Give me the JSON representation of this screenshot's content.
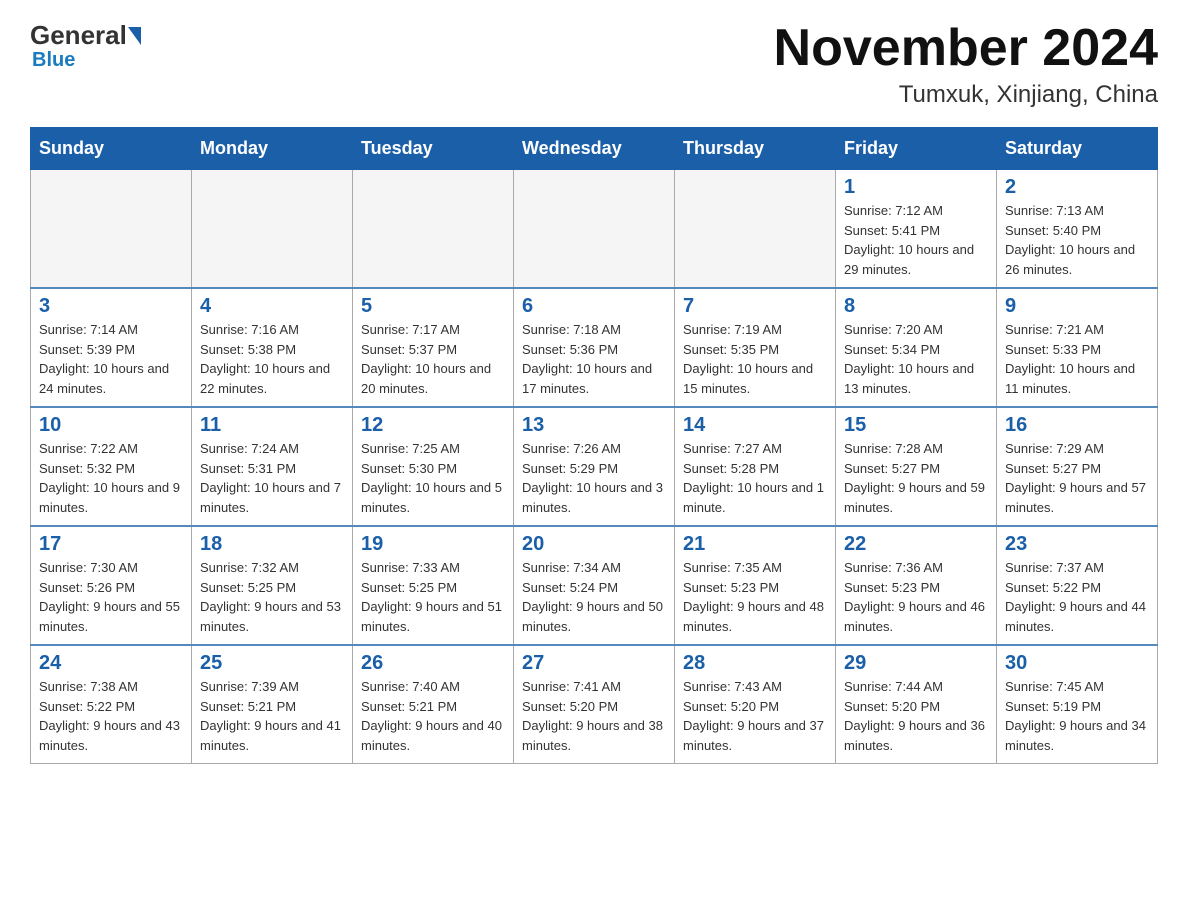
{
  "header": {
    "logo_general": "General",
    "logo_blue": "Blue",
    "title": "November 2024",
    "subtitle": "Tumxuk, Xinjiang, China"
  },
  "days_of_week": [
    "Sunday",
    "Monday",
    "Tuesday",
    "Wednesday",
    "Thursday",
    "Friday",
    "Saturday"
  ],
  "weeks": [
    [
      {
        "day": "",
        "info": ""
      },
      {
        "day": "",
        "info": ""
      },
      {
        "day": "",
        "info": ""
      },
      {
        "day": "",
        "info": ""
      },
      {
        "day": "",
        "info": ""
      },
      {
        "day": "1",
        "info": "Sunrise: 7:12 AM\nSunset: 5:41 PM\nDaylight: 10 hours and 29 minutes."
      },
      {
        "day": "2",
        "info": "Sunrise: 7:13 AM\nSunset: 5:40 PM\nDaylight: 10 hours and 26 minutes."
      }
    ],
    [
      {
        "day": "3",
        "info": "Sunrise: 7:14 AM\nSunset: 5:39 PM\nDaylight: 10 hours and 24 minutes."
      },
      {
        "day": "4",
        "info": "Sunrise: 7:16 AM\nSunset: 5:38 PM\nDaylight: 10 hours and 22 minutes."
      },
      {
        "day": "5",
        "info": "Sunrise: 7:17 AM\nSunset: 5:37 PM\nDaylight: 10 hours and 20 minutes."
      },
      {
        "day": "6",
        "info": "Sunrise: 7:18 AM\nSunset: 5:36 PM\nDaylight: 10 hours and 17 minutes."
      },
      {
        "day": "7",
        "info": "Sunrise: 7:19 AM\nSunset: 5:35 PM\nDaylight: 10 hours and 15 minutes."
      },
      {
        "day": "8",
        "info": "Sunrise: 7:20 AM\nSunset: 5:34 PM\nDaylight: 10 hours and 13 minutes."
      },
      {
        "day": "9",
        "info": "Sunrise: 7:21 AM\nSunset: 5:33 PM\nDaylight: 10 hours and 11 minutes."
      }
    ],
    [
      {
        "day": "10",
        "info": "Sunrise: 7:22 AM\nSunset: 5:32 PM\nDaylight: 10 hours and 9 minutes."
      },
      {
        "day": "11",
        "info": "Sunrise: 7:24 AM\nSunset: 5:31 PM\nDaylight: 10 hours and 7 minutes."
      },
      {
        "day": "12",
        "info": "Sunrise: 7:25 AM\nSunset: 5:30 PM\nDaylight: 10 hours and 5 minutes."
      },
      {
        "day": "13",
        "info": "Sunrise: 7:26 AM\nSunset: 5:29 PM\nDaylight: 10 hours and 3 minutes."
      },
      {
        "day": "14",
        "info": "Sunrise: 7:27 AM\nSunset: 5:28 PM\nDaylight: 10 hours and 1 minute."
      },
      {
        "day": "15",
        "info": "Sunrise: 7:28 AM\nSunset: 5:27 PM\nDaylight: 9 hours and 59 minutes."
      },
      {
        "day": "16",
        "info": "Sunrise: 7:29 AM\nSunset: 5:27 PM\nDaylight: 9 hours and 57 minutes."
      }
    ],
    [
      {
        "day": "17",
        "info": "Sunrise: 7:30 AM\nSunset: 5:26 PM\nDaylight: 9 hours and 55 minutes."
      },
      {
        "day": "18",
        "info": "Sunrise: 7:32 AM\nSunset: 5:25 PM\nDaylight: 9 hours and 53 minutes."
      },
      {
        "day": "19",
        "info": "Sunrise: 7:33 AM\nSunset: 5:25 PM\nDaylight: 9 hours and 51 minutes."
      },
      {
        "day": "20",
        "info": "Sunrise: 7:34 AM\nSunset: 5:24 PM\nDaylight: 9 hours and 50 minutes."
      },
      {
        "day": "21",
        "info": "Sunrise: 7:35 AM\nSunset: 5:23 PM\nDaylight: 9 hours and 48 minutes."
      },
      {
        "day": "22",
        "info": "Sunrise: 7:36 AM\nSunset: 5:23 PM\nDaylight: 9 hours and 46 minutes."
      },
      {
        "day": "23",
        "info": "Sunrise: 7:37 AM\nSunset: 5:22 PM\nDaylight: 9 hours and 44 minutes."
      }
    ],
    [
      {
        "day": "24",
        "info": "Sunrise: 7:38 AM\nSunset: 5:22 PM\nDaylight: 9 hours and 43 minutes."
      },
      {
        "day": "25",
        "info": "Sunrise: 7:39 AM\nSunset: 5:21 PM\nDaylight: 9 hours and 41 minutes."
      },
      {
        "day": "26",
        "info": "Sunrise: 7:40 AM\nSunset: 5:21 PM\nDaylight: 9 hours and 40 minutes."
      },
      {
        "day": "27",
        "info": "Sunrise: 7:41 AM\nSunset: 5:20 PM\nDaylight: 9 hours and 38 minutes."
      },
      {
        "day": "28",
        "info": "Sunrise: 7:43 AM\nSunset: 5:20 PM\nDaylight: 9 hours and 37 minutes."
      },
      {
        "day": "29",
        "info": "Sunrise: 7:44 AM\nSunset: 5:20 PM\nDaylight: 9 hours and 36 minutes."
      },
      {
        "day": "30",
        "info": "Sunrise: 7:45 AM\nSunset: 5:19 PM\nDaylight: 9 hours and 34 minutes."
      }
    ]
  ]
}
